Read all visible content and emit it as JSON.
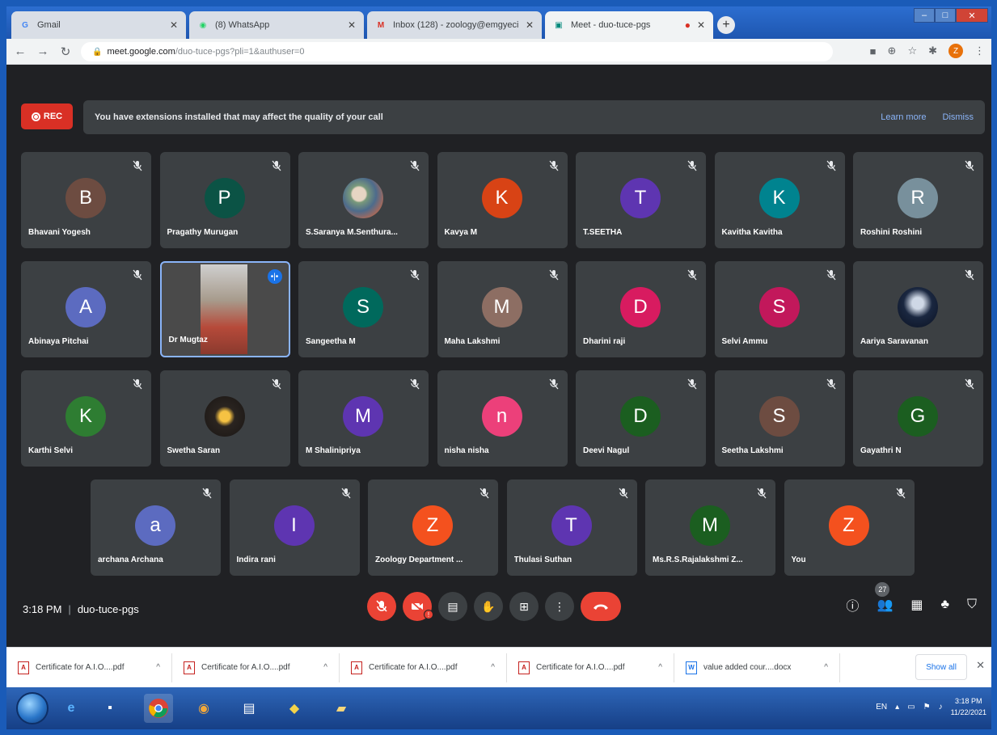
{
  "browser": {
    "tabs": [
      {
        "title": "Gmail",
        "favicon": "google-icon",
        "active": false
      },
      {
        "title": "(8) WhatsApp",
        "favicon": "whatsapp-icon",
        "active": false
      },
      {
        "title": "Inbox (128) - zoology@emgyeci",
        "favicon": "gmail-icon",
        "active": false
      },
      {
        "title": "Meet - duo-tuce-pgs",
        "favicon": "meet-icon",
        "active": true
      }
    ],
    "url_host": "meet.google.com",
    "url_path": "/duo-tuce-pgs?pli=1&authuser=0"
  },
  "meet": {
    "rec_label": "REC",
    "banner_text": "You have extensions installed that may affect the quality of your call",
    "learn_more": "Learn more",
    "dismiss": "Dismiss",
    "participants": [
      {
        "initial": "B",
        "name": "Bhavani Yogesh",
        "color": "#6d4c41"
      },
      {
        "initial": "P",
        "name": "Pragathy Murugan",
        "color": "#0b5345"
      },
      {
        "initial": "",
        "name": "S.Saranya M.Senthura...",
        "color": "photo"
      },
      {
        "initial": "K",
        "name": "Kavya M",
        "color": "#d84315"
      },
      {
        "initial": "T",
        "name": "T.SEETHA",
        "color": "#5e35b1"
      },
      {
        "initial": "K",
        "name": "Kavitha Kavitha",
        "color": "#00838f"
      },
      {
        "initial": "R",
        "name": "Roshini Roshini",
        "color": "#78909c"
      },
      {
        "initial": "A",
        "name": "Abinaya Pitchai",
        "color": "#5c6bc0"
      },
      {
        "initial": "",
        "name": "Dr Mugtaz",
        "color": "video"
      },
      {
        "initial": "S",
        "name": "Sangeetha M",
        "color": "#00695c"
      },
      {
        "initial": "M",
        "name": "Maha Lakshmi",
        "color": "#8d6e63"
      },
      {
        "initial": "D",
        "name": "Dharini raji",
        "color": "#d81b60"
      },
      {
        "initial": "S",
        "name": "Selvi Ammu",
        "color": "#c2185b"
      },
      {
        "initial": "",
        "name": "Aariya Saravanan",
        "color": "photo2"
      },
      {
        "initial": "K",
        "name": "Karthi Selvi",
        "color": "#2e7d32"
      },
      {
        "initial": "",
        "name": "Swetha Saran",
        "color": "photo3"
      },
      {
        "initial": "M",
        "name": "M Shalinipriya",
        "color": "#5e35b1"
      },
      {
        "initial": "n",
        "name": "nisha nisha",
        "color": "#ec407a"
      },
      {
        "initial": "D",
        "name": "Deevi Nagul",
        "color": "#1b5e20"
      },
      {
        "initial": "S",
        "name": "Seetha Lakshmi",
        "color": "#6d4c41"
      },
      {
        "initial": "G",
        "name": "Gayathri N",
        "color": "#1b5e20"
      },
      {
        "initial": "a",
        "name": "archana Archana",
        "color": "#5c6bc0"
      },
      {
        "initial": "I",
        "name": "Indira rani",
        "color": "#5e35b1"
      },
      {
        "initial": "Z",
        "name": "Zoology Department ...",
        "color": "#f4511e"
      },
      {
        "initial": "T",
        "name": "Thulasi Suthan",
        "color": "#5e35b1"
      },
      {
        "initial": "M",
        "name": "Ms.R.S.Rajalakshmi Z...",
        "color": "#1b5e20"
      },
      {
        "initial": "Z",
        "name": "You",
        "color": "#f4511e"
      }
    ],
    "time": "3:18 PM",
    "meeting_code": "duo-tuce-pgs",
    "participant_count": "27"
  },
  "downloads": [
    {
      "name": "Certificate for A.I.O....pdf",
      "type": "pdf"
    },
    {
      "name": "Certificate for A.I.O....pdf",
      "type": "pdf"
    },
    {
      "name": "Certificate for A.I.O....pdf",
      "type": "pdf"
    },
    {
      "name": "Certificate for A.I.O....pdf",
      "type": "pdf"
    },
    {
      "name": "value added cour....docx",
      "type": "doc"
    }
  ],
  "show_all": "Show all",
  "taskbar": {
    "lang": "EN",
    "time": "3:18 PM",
    "date": "11/22/2021"
  }
}
